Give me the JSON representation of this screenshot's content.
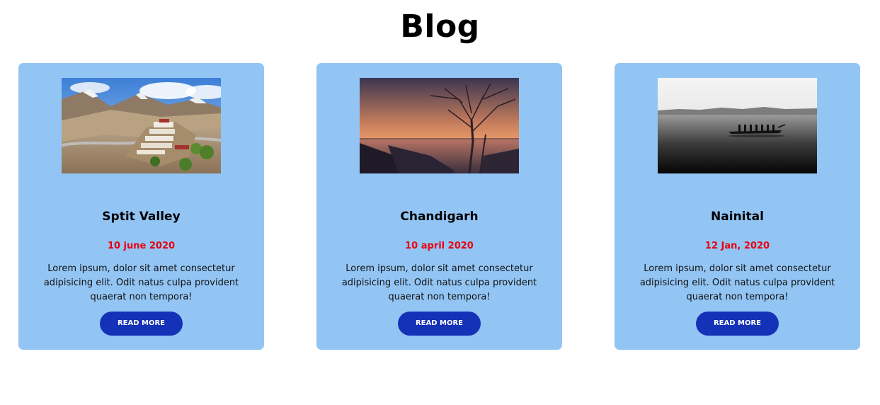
{
  "page": {
    "title": "Blog"
  },
  "colors": {
    "card_background": "#93c5f4",
    "date_color": "#e8000f",
    "button_color": "#1432b8"
  },
  "posts": [
    {
      "title": "Sptit Valley",
      "date": "10 june 2020",
      "excerpt": "Lorem ipsum, dolor sit amet consectetur adipisicing elit. Odit natus culpa provident quaerat non tempora!",
      "button_label": "READ MORE",
      "image": "mountain-monastery-photo"
    },
    {
      "title": "Chandigarh",
      "date": "10 april 2020",
      "excerpt": "Lorem ipsum, dolor sit amet consectetur adipisicing elit. Odit natus culpa provident quaerat non tempora!",
      "button_label": "READ MORE",
      "image": "sunset-lake-tree-photo"
    },
    {
      "title": "Nainital",
      "date": "12 Jan, 2020",
      "excerpt": "Lorem ipsum, dolor sit amet consectetur adipisicing elit. Odit natus culpa provident quaerat non tempora!",
      "button_label": "READ MORE",
      "image": "rowing-boat-lake-photo"
    }
  ]
}
